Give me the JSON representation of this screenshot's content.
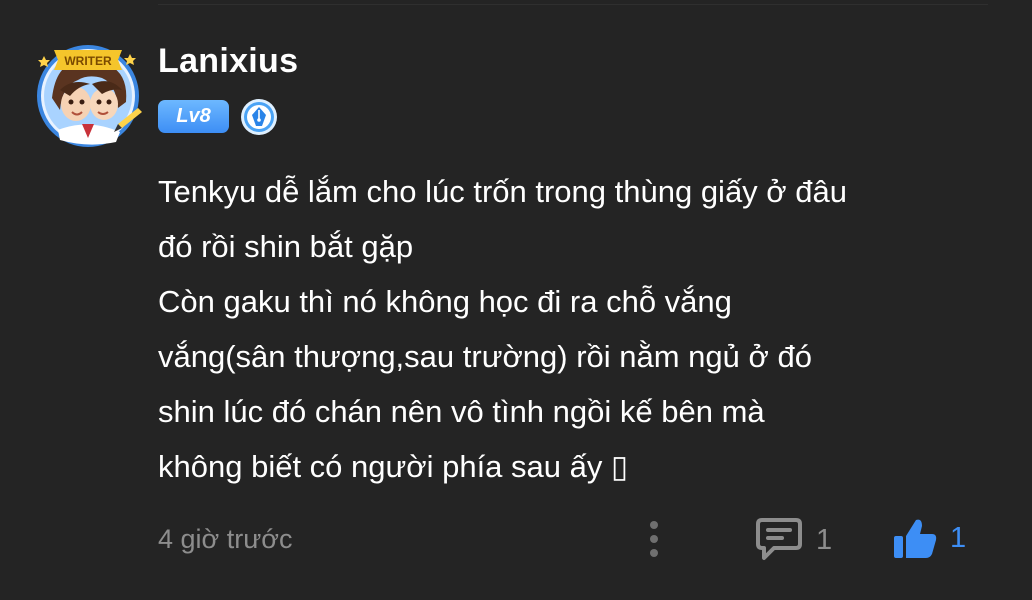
{
  "comment": {
    "author": {
      "name": "Lanixius",
      "avatar_badge_text": "WRITER",
      "level": "Lv8"
    },
    "body_lines": [
      "Tenkyu dễ lắm cho lúc trốn trong thùng giấy ở đâu",
      "đó rồi shin bắt gặp",
      "Còn gaku thì nó không học đi ra chỗ vắng",
      "vắng(sân thượng,sau trường) rồi nằm ngủ ở đó",
      "shin lúc đó chán nên vô tình ngồi kế bên mà",
      "không biết có người phía sau ấy ▯"
    ],
    "timestamp": "4 giờ trước",
    "reply_count": "1",
    "like_count": "1"
  },
  "icons": {
    "writer_badge": "pen-nib-icon",
    "more": "more-vertical-icon",
    "reply": "comment-bubble-icon",
    "like": "thumbs-up-icon"
  },
  "colors": {
    "background": "#242424",
    "level_badge": "#4a9bf7",
    "like_active": "#3d8ef5",
    "muted": "#8d8d8d"
  }
}
